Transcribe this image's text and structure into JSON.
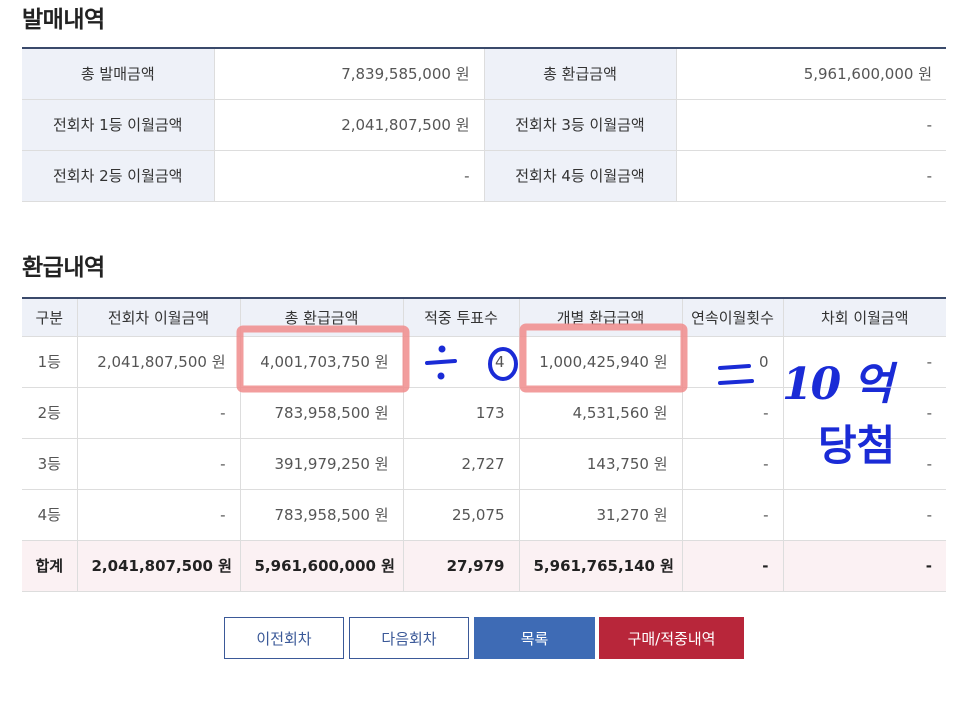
{
  "sales": {
    "title": "발매내역",
    "rows": [
      {
        "label1": "총 발매금액",
        "value1": "7,839,585,000 원",
        "label2": "총 환급금액",
        "value2": "5,961,600,000 원"
      },
      {
        "label1": "전회차 1등 이월금액",
        "value1": "2,041,807,500 원",
        "label2": "전회차 3등 이월금액",
        "value2": "-"
      },
      {
        "label1": "전회차 2등 이월금액",
        "value1": "-",
        "label2": "전회차 4등 이월금액",
        "value2": "-"
      }
    ]
  },
  "refund": {
    "title": "환급내역",
    "headers": [
      "구분",
      "전회차 이월금액",
      "총 환급금액",
      "적중 투표수",
      "개별 환급금액",
      "연속이월횟수",
      "차회 이월금액"
    ],
    "rows": [
      [
        "1등",
        "2,041,807,500 원",
        "4,001,703,750 원",
        "4",
        "1,000,425,940 원",
        "0",
        "-"
      ],
      [
        "2등",
        "-",
        "783,958,500 원",
        "173",
        "4,531,560 원",
        "-",
        "-"
      ],
      [
        "3등",
        "-",
        "391,979,250 원",
        "2,727",
        "143,750 원",
        "-",
        "-"
      ],
      [
        "4등",
        "-",
        "783,958,500 원",
        "25,075",
        "31,270 원",
        "-",
        "-"
      ],
      [
        "합계",
        "2,041,807,500 원",
        "5,961,600,000 원",
        "27,979",
        "5,961,765,140 원",
        "-",
        "-"
      ]
    ]
  },
  "buttons": {
    "prev": "이전회차",
    "next": "다음회차",
    "list": "목록",
    "purchase": "구매/적중내역"
  },
  "annotation": {
    "divide": "÷",
    "zero": "0",
    "equals": "=",
    "amount": "10 억",
    "win": "당첨",
    "color": "#1a2bd6",
    "highlight_color": "#f08c8c"
  }
}
